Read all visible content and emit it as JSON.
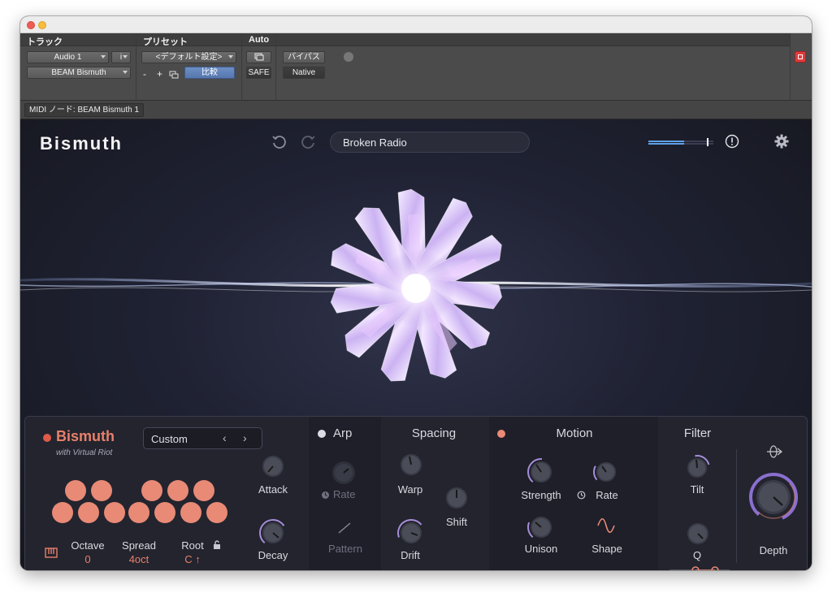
{
  "host": {
    "track_header": "トラック",
    "preset_header": "プリセット",
    "auto_header": "Auto",
    "track_name": "Audio 1",
    "info_button": "i",
    "plugin_select": "BEAM Bismuth",
    "preset_select": "<デフォルト設定>",
    "minus_button": "-",
    "plus_button": "+",
    "compare_button": "比較",
    "safe_button": "SAFE",
    "bypass_button": "バイパス",
    "native_button": "Native",
    "midi_node": "MIDI ノード: BEAM Bismuth 1"
  },
  "plugin": {
    "brand": "Bismuth",
    "preset_name": "Broken Radio",
    "meter_level": 0.55
  },
  "panel": {
    "engine": {
      "name": "Bismuth",
      "subtitle": "with Virtual Riot",
      "mode": "Custom",
      "octave_label": "Octave",
      "octave_value": "0",
      "spread_label": "Spread",
      "spread_value": "4oct",
      "root_label": "Root",
      "root_value": "C ↑",
      "attack_label": "Attack",
      "decay_label": "Decay"
    },
    "arp": {
      "title": "Arp",
      "rate_label": "Rate",
      "pattern_label": "Pattern"
    },
    "spacing": {
      "title": "Spacing",
      "warp_label": "Warp",
      "shift_label": "Shift",
      "drift_label": "Drift"
    },
    "motion": {
      "title": "Motion",
      "strength_label": "Strength",
      "rate_label": "Rate",
      "unison_label": "Unison",
      "shape_label": "Shape"
    },
    "filter": {
      "title": "Filter",
      "tilt_label": "Tilt",
      "q_label": "Q",
      "depth_label": "Depth"
    }
  },
  "colors": {
    "accent": "#e88a76",
    "accent_dark": "#e05a4a",
    "bg": "#1f2233",
    "ring": "#a68ed8"
  }
}
